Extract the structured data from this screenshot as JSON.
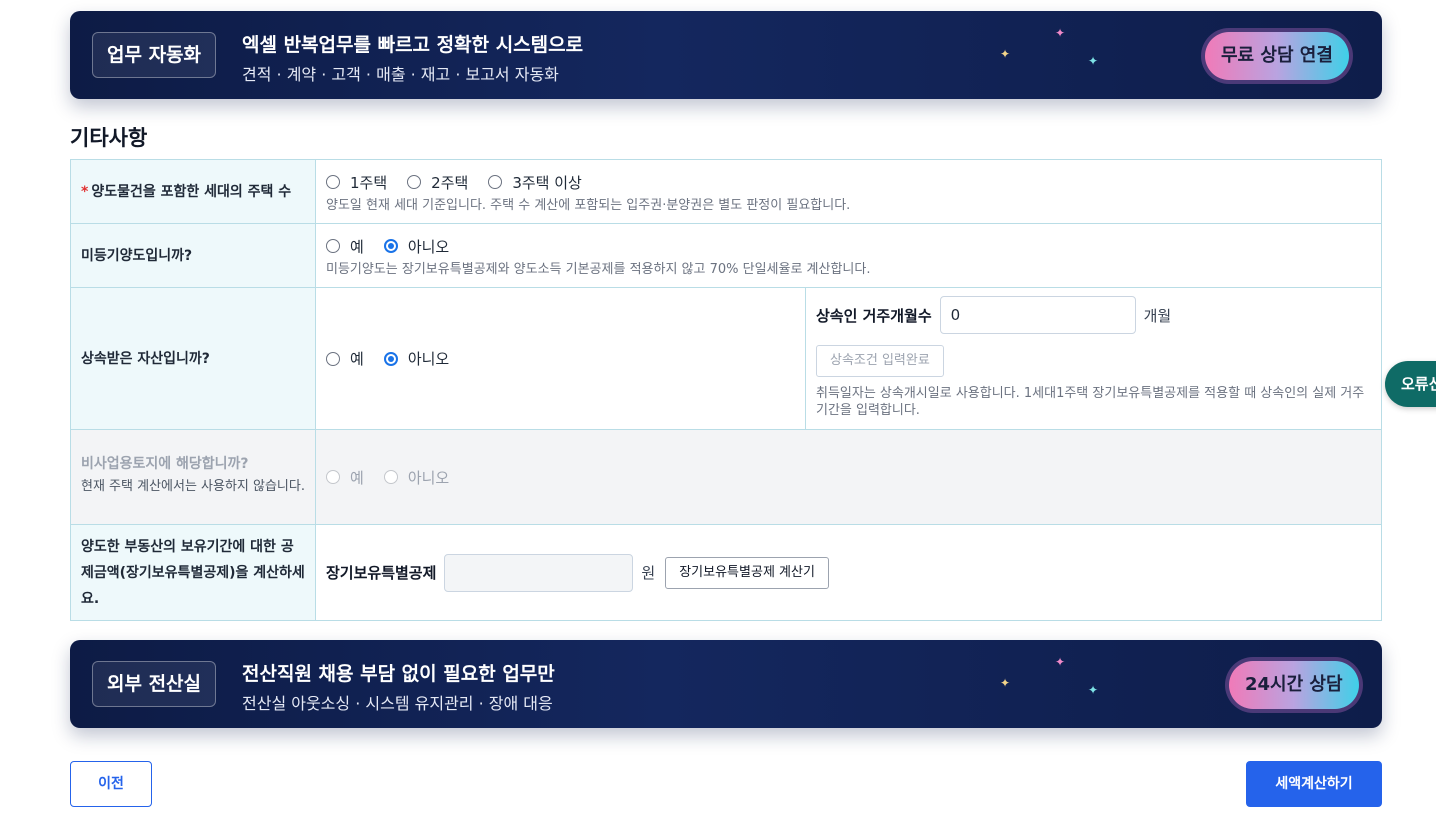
{
  "banner_top": {
    "tag": "업무 자동화",
    "title": "엑셀 반복업무를 빠르고 정확한 시스템으로",
    "subtitle": "견적 · 계약 · 고객 · 매출 · 재고 · 보고서 자동화",
    "button": "무료 상담 연결"
  },
  "section_title": "기타사항",
  "rows": {
    "house_count": {
      "required_mark": "*",
      "label": "양도물건을 포함한 세대의 주택 수",
      "options": [
        "1주택",
        "2주택",
        "3주택 이상"
      ],
      "help": "양도일 현재 세대 기준입니다. 주택 수 계산에 포함되는 입주권·분양권은 별도 판정이 필요합니다."
    },
    "unregistered": {
      "label": "미등기양도입니까?",
      "options": [
        "예",
        "아니오"
      ],
      "selected": "아니오",
      "help": "미등기양도는 장기보유특별공제와 양도소득 기본공제를 적용하지 않고 70% 단일세율로 계산합니다."
    },
    "inherited": {
      "label": "상속받은 자산입니까?",
      "options": [
        "예",
        "아니오"
      ],
      "selected": "아니오",
      "field_label": "상속인 거주개월수",
      "field_value": "0",
      "unit": "개월",
      "complete_button": "상속조건 입력완료",
      "help": "취득일자는 상속개시일로 사용합니다. 1세대1주택 장기보유특별공제를 적용할 때 상속인의 실제 거주기간을 입력합니다."
    },
    "non_business_land": {
      "label": "비사업용토지에 해당합니까?",
      "sub": "현재 주택 계산에서는 사용하지 않습니다.",
      "options": [
        "예",
        "아니오"
      ]
    },
    "long_term": {
      "label": "양도한 부동산의 보유기간에 대한 공제금액(장기보유특별공제)을 계산하세요.",
      "field_label": "장기보유특별공제",
      "unit": "원",
      "calc_button": "장기보유특별공제 계산기"
    }
  },
  "banner_bottom": {
    "tag": "외부 전산실",
    "title": "전산직원 채용 부담 없이 필요한 업무만",
    "subtitle": "전산실 아웃소싱 · 시스템 유지관리 · 장애 대응",
    "button": "24시간 상담"
  },
  "footer": {
    "prev": "이전",
    "calculate": "세액계산하기"
  },
  "side_float": "오류신고",
  "colors": {
    "primary": "#2563eb",
    "banner_bg": "#0d1b45",
    "label_bg": "#eef9fb",
    "border": "#b9dde6",
    "side_float": "#0f6b66"
  }
}
